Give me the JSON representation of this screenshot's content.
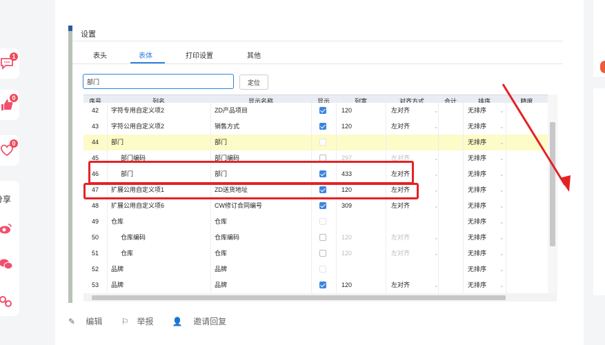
{
  "left_rail": {
    "comment_count": "1",
    "like_count": "0",
    "favorite_count": "0",
    "share_label": "分享"
  },
  "dialog": {
    "title": "设置",
    "tabs": [
      "表头",
      "表体",
      "打印设置",
      "其他"
    ],
    "active_tab": "表体",
    "search_value": "部门",
    "locate_label": "定位",
    "columns": [
      "序号",
      "列名",
      "显示名称",
      "显示",
      "列宽",
      "对齐方式",
      "合计",
      "排序",
      "精度"
    ],
    "rows": [
      {
        "no": "42",
        "name": "字符专用自定义项2",
        "display": "ZD产品项目",
        "show": "on",
        "width": "120",
        "align": "左对齐",
        "sort": "无排序"
      },
      {
        "no": "43",
        "name": "字符公用自定义项2",
        "display": "销售方式",
        "show": "on",
        "width": "120",
        "align": "左对齐",
        "sort": "无排序"
      },
      {
        "no": "44",
        "name": "部门",
        "display": "部门",
        "show": "disabled",
        "width": "",
        "align": "",
        "sort": "无排序"
      },
      {
        "no": "45",
        "name": "部门编码",
        "display": "部门编码",
        "show": "off",
        "width": "297",
        "align": "左对齐",
        "sort": "无排序"
      },
      {
        "no": "46",
        "name": "部门",
        "display": "部门",
        "show": "on",
        "width": "433",
        "align": "左对齐",
        "sort": "无排序"
      },
      {
        "no": "47",
        "name": "扩展公用自定义项1",
        "display": "ZD送货地址",
        "show": "on",
        "width": "120",
        "align": "左对齐",
        "sort": "无排序"
      },
      {
        "no": "48",
        "name": "扩展公用自定义项6",
        "display": "CW修订合同编号",
        "show": "on",
        "width": "309",
        "align": "左对齐",
        "sort": "无排序"
      },
      {
        "no": "49",
        "name": "仓库",
        "display": "仓库",
        "show": "disabled",
        "width": "",
        "align": "",
        "sort": "无排序"
      },
      {
        "no": "50",
        "name": "仓库编码",
        "display": "仓库编码",
        "show": "off",
        "width": "120",
        "align": "左对齐",
        "sort": "无排序"
      },
      {
        "no": "51",
        "name": "仓库",
        "display": "仓库",
        "show": "off",
        "width": "120",
        "align": "左对齐",
        "sort": "无排序"
      },
      {
        "no": "52",
        "name": "品牌",
        "display": "品牌",
        "show": "disabled",
        "width": "",
        "align": "",
        "sort": "无排序"
      },
      {
        "no": "53",
        "name": "品牌",
        "display": "品牌",
        "show": "on",
        "width": "120",
        "align": "左对齐",
        "sort": "无排序"
      }
    ]
  },
  "footer": {
    "edit": "编辑",
    "report": "举报",
    "invite": "邀请回复"
  },
  "colors": {
    "accent": "#2d7fe0",
    "annotation_red": "#e52124",
    "highlight_row": "#fdfbc8",
    "badge": "#f04a5a"
  }
}
